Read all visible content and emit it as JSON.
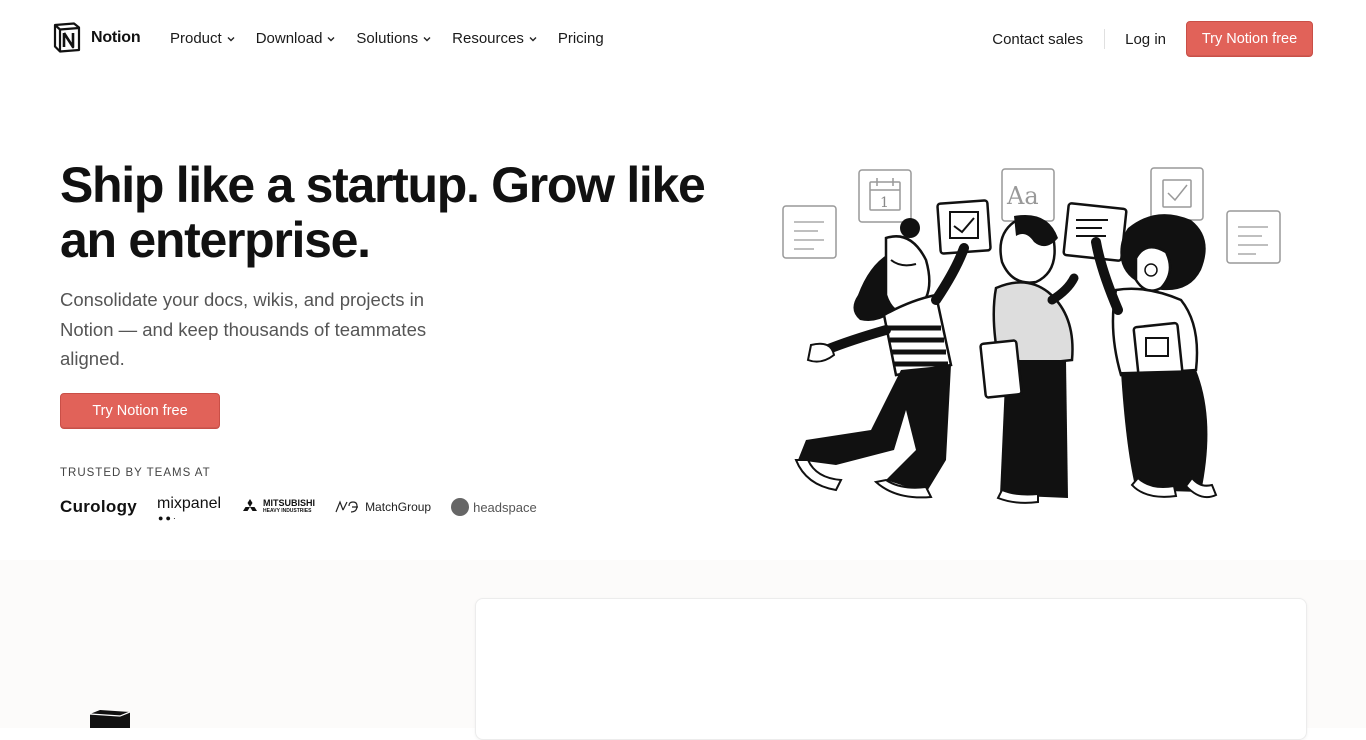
{
  "brand": {
    "name": "Notion"
  },
  "nav": {
    "items": [
      {
        "label": "Product",
        "has_dropdown": true
      },
      {
        "label": "Download",
        "has_dropdown": true
      },
      {
        "label": "Solutions",
        "has_dropdown": true
      },
      {
        "label": "Resources",
        "has_dropdown": true
      },
      {
        "label": "Pricing",
        "has_dropdown": false
      }
    ],
    "contact_sales": "Contact sales",
    "login": "Log in",
    "cta": "Try Notion free"
  },
  "hero": {
    "title": "Ship like a startup. Grow like an enterprise.",
    "subtitle": "Consolidate your docs, wikis, and projects in Notion — and keep thousands of teammates aligned.",
    "cta": "Try Notion free",
    "trusted_label": "TRUSTED BY TEAMS AT",
    "logos": [
      "Curology",
      "mixpanel",
      "MITSUBISHI",
      "HEAVY INDUSTRIES",
      "MatchGroup",
      "headspace"
    ]
  },
  "colors": {
    "accent": "#e16259",
    "text": "#111111",
    "muted": "#555555"
  }
}
